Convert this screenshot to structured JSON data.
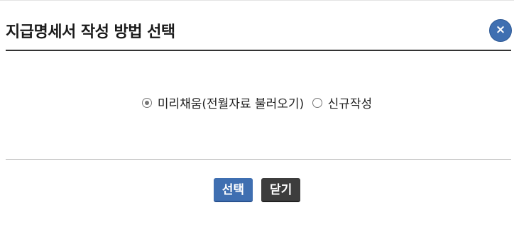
{
  "dialog": {
    "title": "지급명세서 작성 방법 선택",
    "close_label": "×"
  },
  "options": [
    {
      "label": "미리채움(전월자료 불러오기)",
      "checked": true
    },
    {
      "label": "신규작성",
      "checked": false
    }
  ],
  "buttons": {
    "select_label": "선택",
    "close_label": "닫기"
  },
  "colors": {
    "primary": "#3f6fb1",
    "dark_button": "#3d3d3d"
  }
}
